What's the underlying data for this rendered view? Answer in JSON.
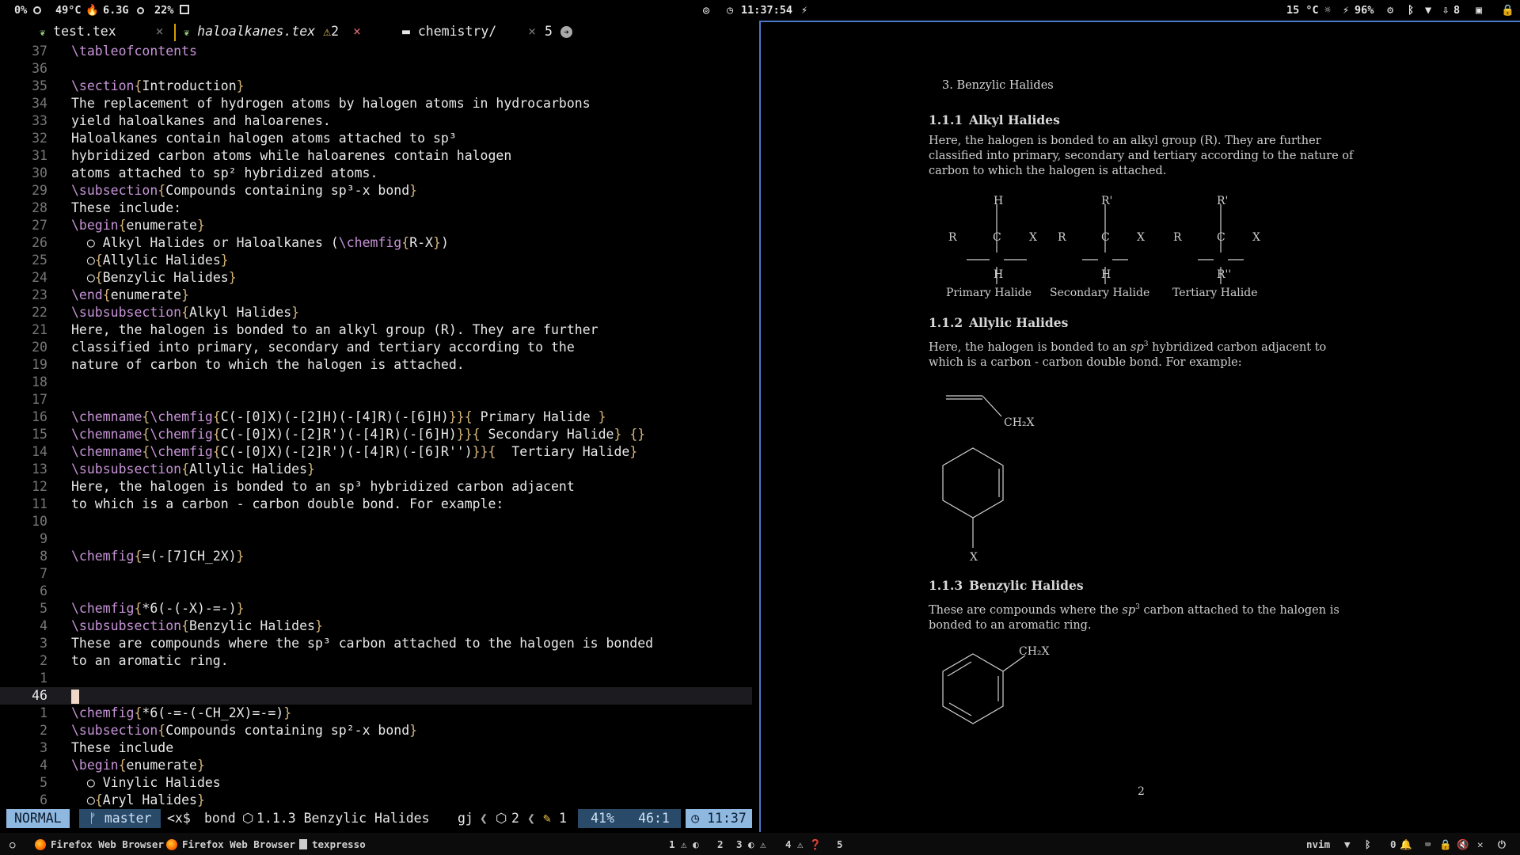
{
  "topbar": {
    "cpu": "0%",
    "temp": "49°C",
    "mem": "6.3G",
    "disk": "22%",
    "time": "11:37:54",
    "weather": "15 °C",
    "battery": "96%",
    "downloads": "8"
  },
  "tabs": [
    {
      "label": "test.tex"
    },
    {
      "label": "haloalkanes.tex",
      "warn": "2"
    },
    {
      "label": "chemistry/"
    },
    {
      "label": "5"
    }
  ],
  "editor": {
    "lines": [
      {
        "num": "37",
        "text": "\\tableofcontents"
      },
      {
        "num": "36",
        "text": ""
      },
      {
        "num": "35",
        "text": "\\section{Introduction}"
      },
      {
        "num": "34",
        "text": "The replacement of hydrogen atoms by halogen atoms in hydrocarbons"
      },
      {
        "num": "33",
        "text": "yield haloalkanes and haloarenes."
      },
      {
        "num": "32",
        "text": "Haloalkanes contain halogen atoms attached to sp³"
      },
      {
        "num": "31",
        "text": "hybridized carbon atoms while haloarenes contain halogen"
      },
      {
        "num": "30",
        "text": "atoms attached to sp² hybridized atoms."
      },
      {
        "num": "29",
        "text": "\\subsection{Compounds containing sp³-x bond}"
      },
      {
        "num": "28",
        "text": "These include:"
      },
      {
        "num": "27",
        "text": "\\begin{enumerate}"
      },
      {
        "num": "26",
        "text": "  ○ Alkyl Halides or Haloalkanes (\\chemfig{R-X})"
      },
      {
        "num": "25",
        "text": "  ○{Allylic Halides}"
      },
      {
        "num": "24",
        "text": "  ○{Benzylic Halides}"
      },
      {
        "num": "23",
        "text": "\\end{enumerate}"
      },
      {
        "num": "22",
        "text": "\\subsubsection{Alkyl Halides}"
      },
      {
        "num": "21",
        "text": "Here, the halogen is bonded to an alkyl group (R). They are further"
      },
      {
        "num": "20",
        "text": "classified into primary, secondary and tertiary according to the"
      },
      {
        "num": "19",
        "text": "nature of carbon to which the halogen is attached."
      },
      {
        "num": "18",
        "text": ""
      },
      {
        "num": "17",
        "text": ""
      },
      {
        "num": "16",
        "text": "\\chemname{\\chemfig{C(-[0]X)(-[2]H)(-[4]R)(-[6]H)}}{ Primary Halide }"
      },
      {
        "num": "15",
        "text": "\\chemname{\\chemfig{C(-[0]X)(-[2]R')(-[4]R)(-[6]H)}}{ Secondary Halide} {}"
      },
      {
        "num": "14",
        "text": "\\chemname{\\chemfig{C(-[0]X)(-[2]R')(-[4]R)(-[6]R'')}}{  Tertiary Halide}"
      },
      {
        "num": "13",
        "text": "\\subsubsection{Allylic Halides}"
      },
      {
        "num": "12",
        "text": "Here, the halogen is bonded to an sp³ hybridized carbon adjacent"
      },
      {
        "num": "11",
        "text": "to which is a carbon - carbon double bond. For example:"
      },
      {
        "num": "10",
        "text": ""
      },
      {
        "num": "9",
        "text": ""
      },
      {
        "num": "8",
        "text": "\\chemfig{=(-[7]CH_2X)}"
      },
      {
        "num": "7",
        "text": ""
      },
      {
        "num": "6",
        "text": ""
      },
      {
        "num": "5",
        "text": "\\chemfig{*6(-(-X)-=-)}"
      },
      {
        "num": "4",
        "text": "\\subsubsection{Benzylic Halides}"
      },
      {
        "num": "3",
        "text": "These are compounds where the sp³ carbon attached to the halogen is bonded"
      },
      {
        "num": "2",
        "text": "to an aromatic ring."
      },
      {
        "num": "1",
        "text": ""
      },
      {
        "num": "46",
        "text": ""
      },
      {
        "num": "1",
        "text": "\\chemfig{*6(-=-(-CH_2X)=-=)}"
      },
      {
        "num": "2",
        "text": "\\subsection{Compounds containing sp²-x bond}"
      },
      {
        "num": "3",
        "text": "These include"
      },
      {
        "num": "4",
        "text": "\\begin{enumerate}"
      },
      {
        "num": "5",
        "text": "  ○ Vinylic Halides"
      },
      {
        "num": "6",
        "text": "  ○{Aryl Halides}"
      }
    ]
  },
  "status": {
    "mode": "NORMAL",
    "branch": "master",
    "keys": "<x$",
    "word": "bond",
    "breadcrumb": "1.1.3 Benzylic Halides",
    "gj": "gj",
    "count1": "2",
    "count2": "1",
    "percent": "41%",
    "position": "46:1",
    "clock": "11:37"
  },
  "pdf": {
    "list_item": "3.  Benzylic Halides",
    "sec1_num": "1.1.1",
    "sec1_title": "Alkyl Halides",
    "sec1_body": "Here, the halogen is bonded to an alkyl group (R). They are further classified into primary, secondary and tertiary according to the nature of carbon to which the halogen is attached.",
    "primary": "Primary Halide",
    "secondary": "Secondary Halide",
    "tertiary": "Tertiary Halide",
    "sec2_num": "1.1.2",
    "sec2_title": "Allylic Halides",
    "sec2_body_a": "Here, the halogen is bonded to an ",
    "sec2_sp": "sp",
    "sec2_body_b": " hybridized carbon adjacent to which is a carbon - carbon double bond. For example:",
    "sec3_num": "1.1.3",
    "sec3_title": "Benzylic Halides",
    "sec3_body_a": "These are compounds where the ",
    "sec3_body_b": " carbon attached to the halogen is bonded to an aromatic ring.",
    "page_number": "2",
    "labels": {
      "H": "H",
      "R": "R",
      "C": "C",
      "X": "X",
      "Rp": "R'",
      "Rpp": "R''",
      "CH2X": "CH₂X",
      "sup3": "3"
    }
  },
  "bottombar": {
    "apps": [
      "Firefox Web Browser",
      "Firefox Web Browser",
      "texpresso"
    ],
    "workspaces": [
      "1",
      "2",
      "3",
      "4",
      "5"
    ],
    "right_label": "nvim",
    "notif": "0"
  }
}
